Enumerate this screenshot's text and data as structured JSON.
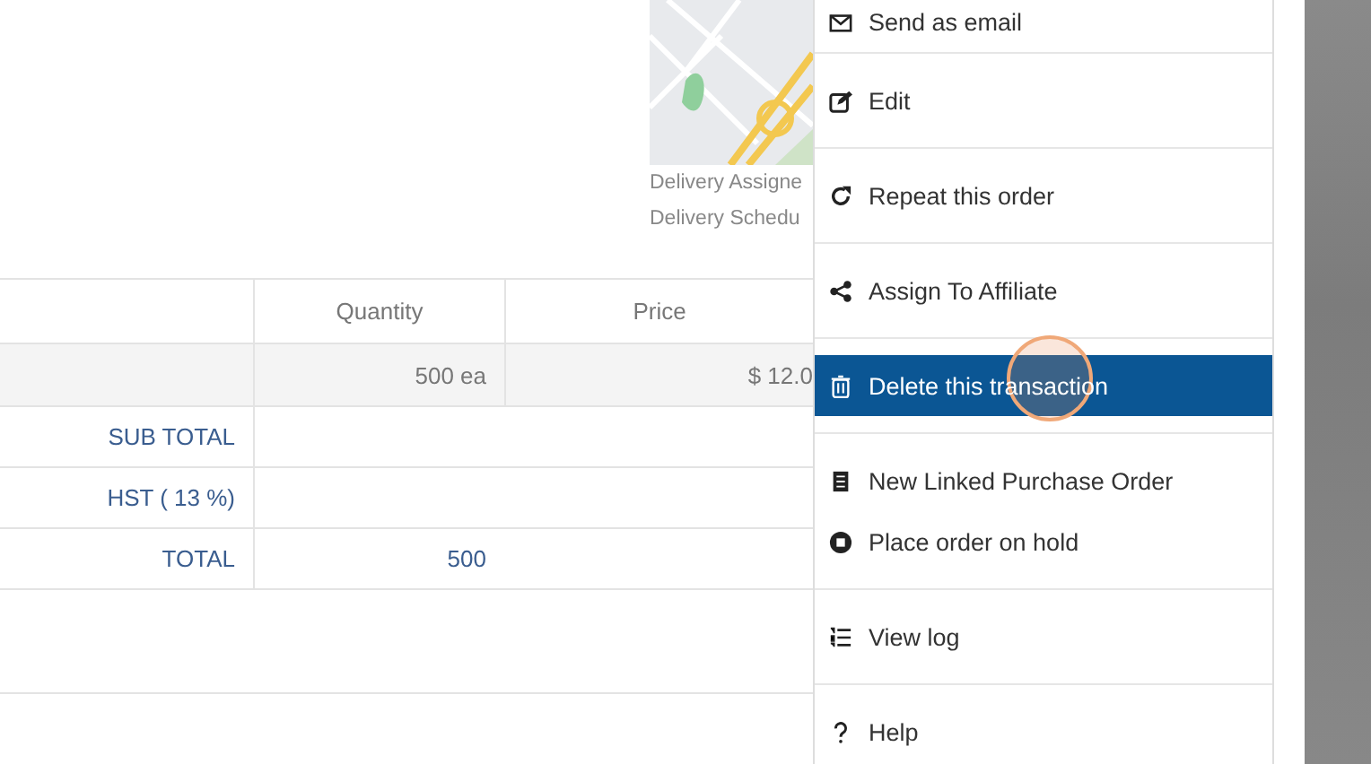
{
  "delivery_lines": [
    "Delivery Assigne",
    "Delivery Schedu"
  ],
  "table": {
    "columns": [
      "Quantity",
      "Price"
    ],
    "rows": [
      {
        "kind": "item",
        "label": "",
        "quantity": "500 ea",
        "price": "$ 12.0"
      },
      {
        "kind": "summary",
        "label": "SUB TOTAL",
        "quantity": "",
        "price": ""
      },
      {
        "kind": "summary",
        "label": "HST ( 13 %)",
        "quantity": "",
        "price": ""
      },
      {
        "kind": "summary",
        "label": "TOTAL",
        "quantity": "500",
        "price": ""
      }
    ]
  },
  "menu": {
    "groups": [
      {
        "items": [
          {
            "label": "Send as email",
            "selected": false
          }
        ]
      },
      {
        "items": [
          {
            "label": "Edit",
            "selected": false
          }
        ]
      },
      {
        "items": [
          {
            "label": "Repeat this order",
            "selected": false
          }
        ]
      },
      {
        "items": [
          {
            "label": "Assign To Affiliate",
            "selected": false
          }
        ]
      },
      {
        "items": [
          {
            "label": "Delete this transaction",
            "selected": true
          }
        ]
      },
      {
        "items": [
          {
            "label": "New Linked Purchase Order",
            "selected": false
          },
          {
            "label": "Place order on hold",
            "selected": false
          }
        ]
      },
      {
        "items": [
          {
            "label": "View log",
            "selected": false
          }
        ]
      },
      {
        "items": [
          {
            "label": "Help",
            "selected": false
          }
        ]
      }
    ]
  }
}
